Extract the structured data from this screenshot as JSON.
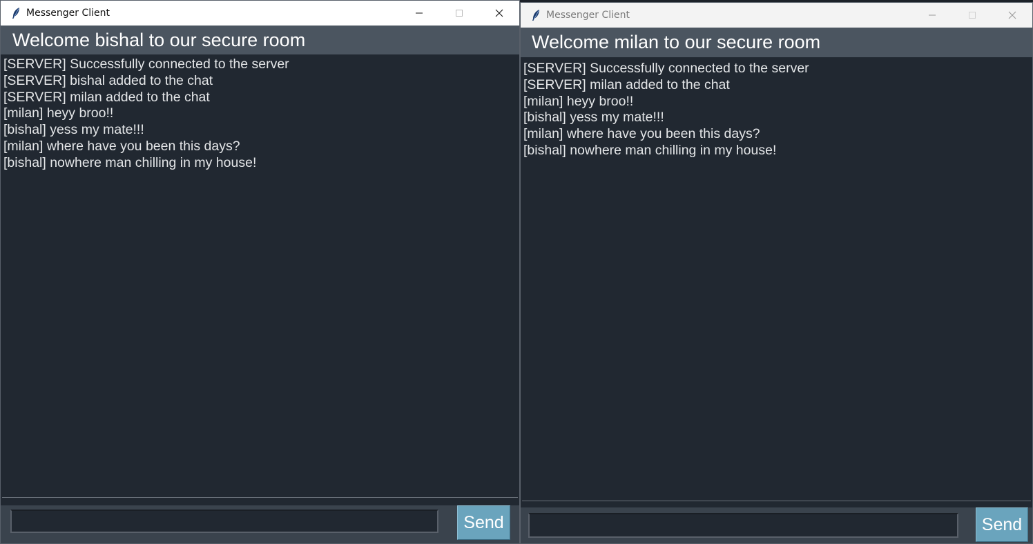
{
  "windows": [
    {
      "title": "Messenger Client",
      "header": "Welcome bishal to our secure room",
      "messages": [
        "[SERVER] Successfully connected to the server",
        "[SERVER] bishal added to the chat",
        "[SERVER] milan added to the chat",
        "[milan] heyy broo!!",
        "[bishal] yess my mate!!!",
        "[milan] where have you been this days?",
        "[bishal] nowhere man chilling in my house!"
      ],
      "input_value": "",
      "send_label": "Send"
    },
    {
      "title": "Messenger Client",
      "header": "Welcome milan to our secure room",
      "messages": [
        "[SERVER] Successfully connected to the server",
        "[SERVER] milan added to the chat",
        "[milan] heyy broo!!",
        "[bishal] yess my mate!!!",
        "[milan] where have you been this days?",
        "[bishal] nowhere man chilling in my house!"
      ],
      "input_value": "",
      "send_label": "Send"
    }
  ],
  "colors": {
    "chat_bg": "#212831",
    "header_bg": "#4b5560",
    "footer_bg": "#3a434d",
    "send_button": "#6aa4bd",
    "text": "#e4e6e8"
  },
  "icons": {
    "app": "feather-icon",
    "minimize": "minimize-icon",
    "maximize": "maximize-icon",
    "close": "close-icon"
  }
}
